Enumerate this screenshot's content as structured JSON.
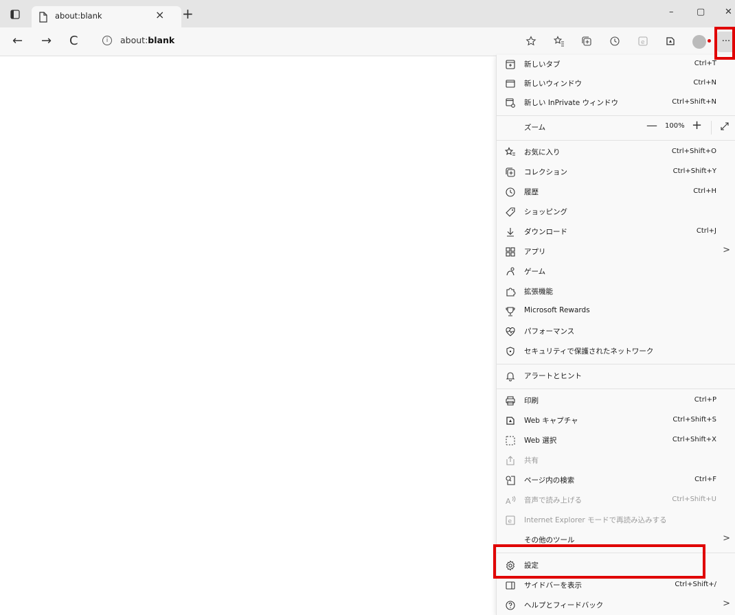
{
  "tab": {
    "title": "about:blank",
    "close": "×",
    "new_tab": "+"
  },
  "window": {
    "minimize": "–",
    "maximize": "▢",
    "close": "✕"
  },
  "nav": {
    "back": "←",
    "forward": "→",
    "refresh": "C"
  },
  "address": {
    "prefix": "about:",
    "bold": "blank"
  },
  "toolbar": {
    "more": "···"
  },
  "menu": {
    "new_tab": {
      "label": "新しいタブ",
      "shortcut": "Ctrl+T"
    },
    "new_window": {
      "label": "新しいウィンドウ",
      "shortcut": "Ctrl+N"
    },
    "new_inprivate": {
      "label": "新しい InPrivate ウィンドウ",
      "shortcut": "Ctrl+Shift+N"
    },
    "zoom": {
      "label": "ズーム",
      "minus": "—",
      "value": "100%",
      "plus": "+"
    },
    "favorites": {
      "label": "お気に入り",
      "shortcut": "Ctrl+Shift+O"
    },
    "collections": {
      "label": "コレクション",
      "shortcut": "Ctrl+Shift+Y"
    },
    "history": {
      "label": "履歴",
      "shortcut": "Ctrl+H"
    },
    "shopping": {
      "label": "ショッピング"
    },
    "downloads": {
      "label": "ダウンロード",
      "shortcut": "Ctrl+J"
    },
    "apps": {
      "label": "アプリ",
      "arrow": ">"
    },
    "games": {
      "label": "ゲーム"
    },
    "extensions": {
      "label": "拡張機能"
    },
    "rewards": {
      "label": "Microsoft Rewards"
    },
    "performance": {
      "label": "パフォーマンス"
    },
    "secure_network": {
      "label": "セキュリティで保護されたネットワーク"
    },
    "alerts": {
      "label": "アラートとヒント"
    },
    "print": {
      "label": "印刷",
      "shortcut": "Ctrl+P"
    },
    "web_capture": {
      "label": "Web キャプチャ",
      "shortcut": "Ctrl+Shift+S"
    },
    "web_select": {
      "label": "Web 選択",
      "shortcut": "Ctrl+Shift+X"
    },
    "share": {
      "label": "共有"
    },
    "find": {
      "label": "ページ内の検索",
      "shortcut": "Ctrl+F"
    },
    "read_aloud": {
      "label": "音声で読み上げる",
      "shortcut": "Ctrl+Shift+U"
    },
    "ie_mode": {
      "label": "Internet Explorer モードで再読み込みする"
    },
    "more_tools": {
      "label": "その他のツール",
      "arrow": ">"
    },
    "settings": {
      "label": "設定"
    },
    "sidebar": {
      "label": "サイドバーを表示",
      "shortcut": "Ctrl+Shift+/"
    },
    "help": {
      "label": "ヘルプとフィードバック",
      "arrow": ">"
    }
  },
  "colors": {
    "highlight": "#e00000",
    "tabbar": "#e5e5e5",
    "toolbar": "#f7f7f7",
    "menu_bg": "#f9f9f9"
  }
}
